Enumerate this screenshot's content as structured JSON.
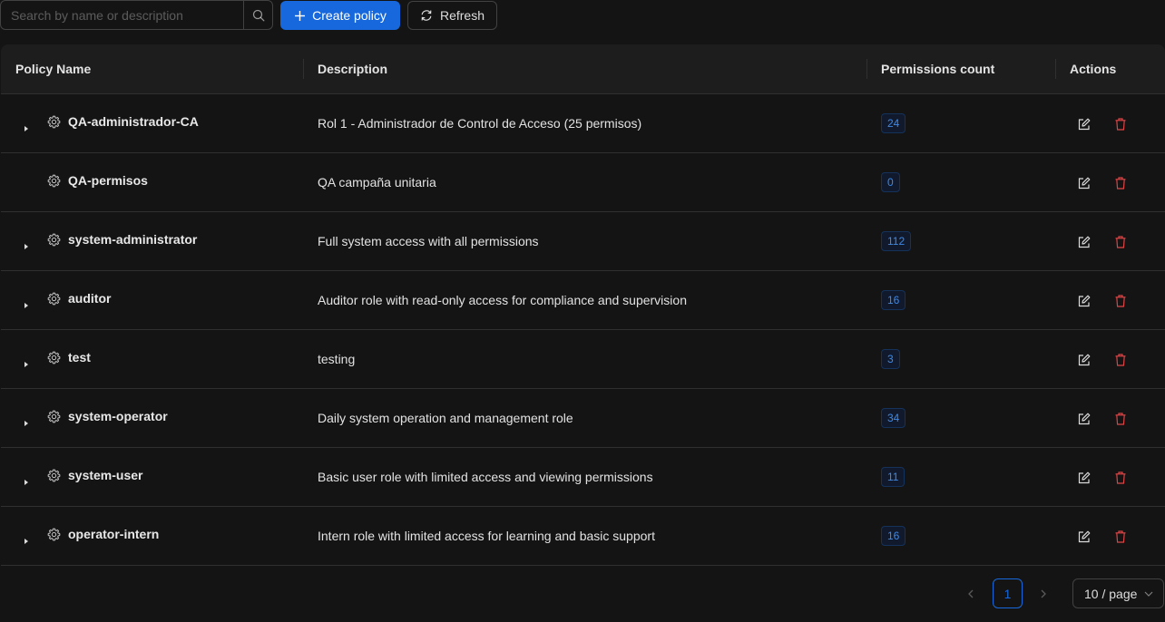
{
  "toolbar": {
    "search_placeholder": "Search by name or description",
    "create_label": "Create policy",
    "refresh_label": "Refresh"
  },
  "table": {
    "columns": [
      "Policy Name",
      "Description",
      "Permissions count",
      "Actions"
    ],
    "rows": [
      {
        "name": "QA-administrador-CA",
        "description": "Rol 1 - Administrador de Control de Acceso (25 permisos)",
        "count": "24",
        "expandable": true
      },
      {
        "name": "QA-permisos",
        "description": "QA campaña unitaria",
        "count": "0",
        "expandable": false
      },
      {
        "name": "system-administrator",
        "description": "Full system access with all permissions",
        "count": "112",
        "expandable": true
      },
      {
        "name": "auditor",
        "description": "Auditor role with read-only access for compliance and supervision",
        "count": "16",
        "expandable": true
      },
      {
        "name": "test",
        "description": "testing",
        "count": "3",
        "expandable": true
      },
      {
        "name": "system-operator",
        "description": "Daily system operation and management role",
        "count": "34",
        "expandable": true
      },
      {
        "name": "system-user",
        "description": "Basic user role with limited access and viewing permissions",
        "count": "11",
        "expandable": true
      },
      {
        "name": "operator-intern",
        "description": "Intern role with limited access for learning and basic support",
        "count": "16",
        "expandable": true
      }
    ]
  },
  "pagination": {
    "current_page": "1",
    "page_size": "10 / page"
  },
  "colors": {
    "primary": "#1668dc",
    "danger": "#dc4446",
    "background": "#141414"
  }
}
